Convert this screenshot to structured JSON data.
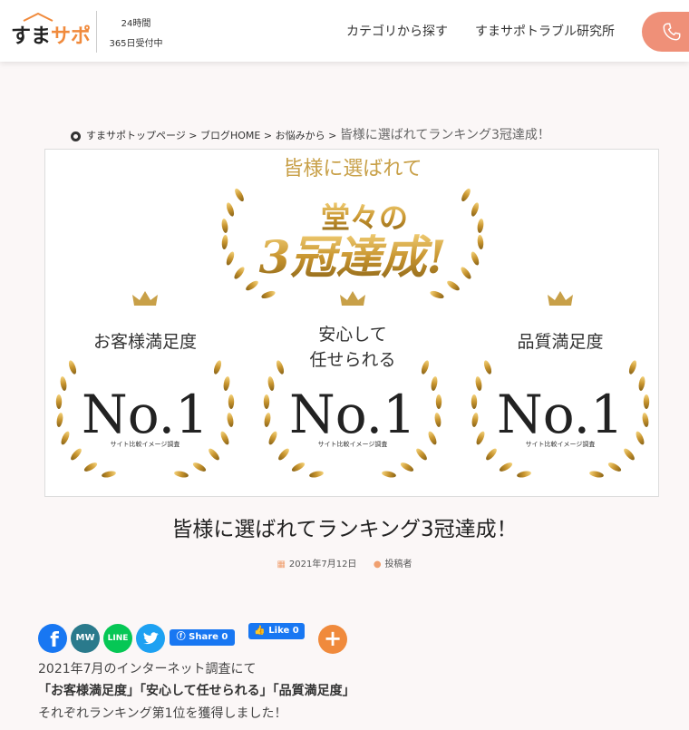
{
  "header": {
    "logo": {
      "part1": "すま",
      "part2": "サポ"
    },
    "hours_line1": "24時間",
    "hours_line2": "365日受付中",
    "nav": [
      {
        "label": "カテゴリから探す"
      },
      {
        "label": "すまサポトラブル研究所"
      }
    ]
  },
  "breadcrumb": {
    "items": [
      "すまサポトップページ",
      "ブログHOME",
      "お悩みから"
    ],
    "separator": ">",
    "current": "皆様に選ばれてランキング3冠達成！"
  },
  "hero": {
    "heading": "皆様に選ばれて",
    "big": "3冠達成!",
    "accent": "堂々の",
    "awards": [
      {
        "line1": "お客様満足度",
        "line2": "",
        "rank": "No.1",
        "note": "サイト比較イメージ調査"
      },
      {
        "line1": "安心して",
        "line2": "任せられる",
        "rank": "No.1",
        "note": "サイト比較イメージ調査"
      },
      {
        "line1": "品質満足度",
        "line2": "",
        "rank": "No.1",
        "note": "サイト比較イメージ調査"
      }
    ]
  },
  "article": {
    "title": "皆様に選ばれてランキング3冠達成！",
    "date": "2021年7月12日",
    "author": "投稿者"
  },
  "share": {
    "icons": [
      "facebook-icon",
      "mixi-icon",
      "line-icon",
      "twitter-icon"
    ],
    "line_label": "LINE",
    "mw_label": "MW",
    "fb_share": "Share 0",
    "fb_like": "Like 0",
    "plus": "+"
  },
  "body": {
    "p1": "2021年7月のインターネット調査にて",
    "p2": "「お客様満足度」「安心して任せられる」「品質満足度」",
    "p3": "それぞれランキング第1位を獲得しました！"
  },
  "colors": {
    "accent": "#f08a3c",
    "gold": "#c8a048",
    "facebook": "#1877f2",
    "line": "#06c755",
    "twitter": "#1da1f2"
  }
}
